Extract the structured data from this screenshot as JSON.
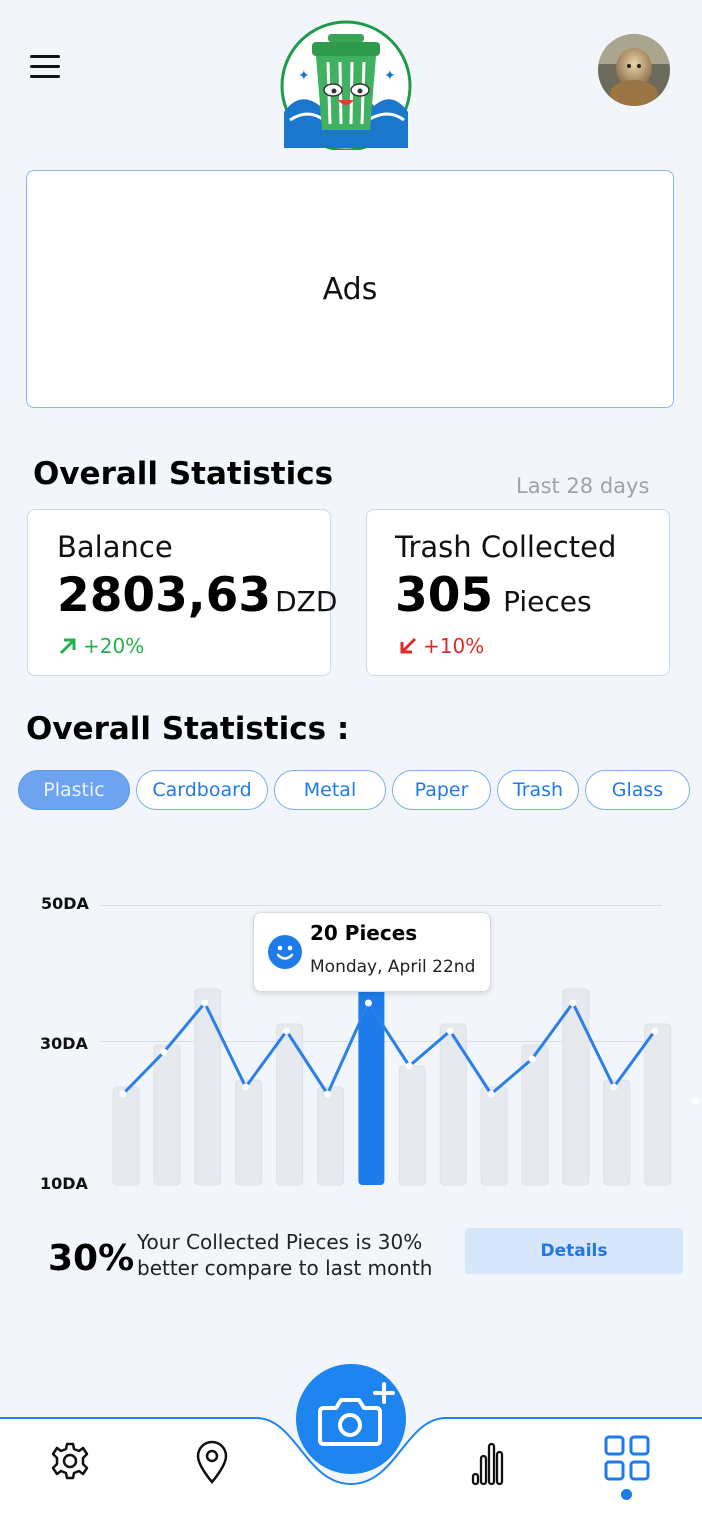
{
  "header": {
    "menu_icon": "hamburger-icon",
    "logo_icon": "trash-bin-mascot-logo",
    "avatar_icon": "user-avatar-photo"
  },
  "ads": {
    "label": "Ads"
  },
  "overall": {
    "title": "Overall Statistics",
    "period": "Last 28 days",
    "balance": {
      "label": "Balance",
      "value": "2803,63",
      "unit": "DZD",
      "trend": "+20%",
      "trend_color": "#22b14c",
      "trend_icon": "arrow-up-right-icon"
    },
    "trash": {
      "label": "Trash Collected",
      "value": "305",
      "unit": "Pieces",
      "trend": "+10%",
      "trend_color": "#e02a2a",
      "trend_icon": "arrow-down-left-icon"
    }
  },
  "stats": {
    "title": "Overall Statistics :",
    "categories": [
      {
        "label": "Plastic",
        "active": true
      },
      {
        "label": "Cardboard",
        "active": false
      },
      {
        "label": "Metal",
        "active": false
      },
      {
        "label": "Paper",
        "active": false
      },
      {
        "label": "Trash",
        "active": false
      },
      {
        "label": "Glass",
        "active": false
      }
    ]
  },
  "chart_data": {
    "type": "bar",
    "y_ticks": [
      "50DA",
      "30DA",
      "10DA"
    ],
    "ylim": [
      10,
      50
    ],
    "bar_values": [
      24,
      30,
      38,
      25,
      33,
      24,
      38,
      27,
      33,
      24,
      30,
      38,
      25,
      33
    ],
    "line_values": [
      23,
      29,
      36,
      24,
      32,
      23,
      36,
      27,
      32,
      23,
      28,
      36,
      24,
      32,
      22
    ],
    "highlight_index": 6,
    "bar_color": "#e6e9ee",
    "highlight_color": "#1e7bea",
    "line_color": "#2a7fe8"
  },
  "tooltip": {
    "title": "20 Pieces",
    "subtitle": "Monday, April 22nd",
    "icon": "smiley-face-icon"
  },
  "summary": {
    "percent": "30%",
    "line1": "Your Collected Pieces is 30%",
    "line2": "better compare to last month",
    "details_label": "Details"
  },
  "bottom_nav": {
    "items": [
      "settings-gear-icon",
      "location-pin-icon",
      "camera-add-icon",
      "bar-chart-icon",
      "grid-dashboard-icon"
    ],
    "active": "grid-dashboard-icon",
    "accent": "#1d84f0"
  }
}
